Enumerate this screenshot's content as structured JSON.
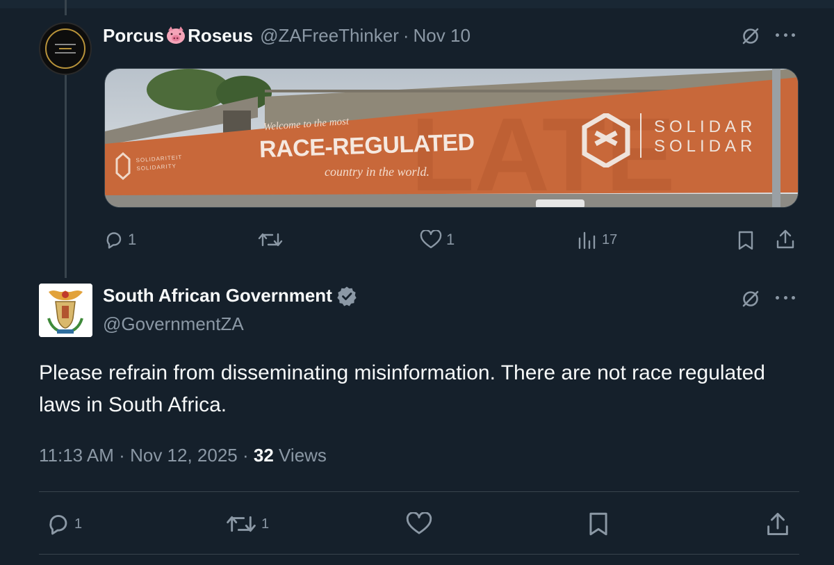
{
  "reply_tweet": {
    "display_name_first": "Porcus",
    "display_name_emoji": "pig-face-emoji",
    "display_name_second": "Roseus",
    "handle": "@ZAFreeThinker",
    "separator": "·",
    "date": "Nov 10",
    "media": {
      "banner_line1": "Welcome to the most",
      "banner_headline": "RACE-REGULATED",
      "banner_line3": "country in the world.",
      "brand_right_1": "SOLIDAR",
      "brand_right_2": "SOLIDAR",
      "brand_left_1": "SOLIDARITEIT",
      "brand_left_2": "SOLIDARITY",
      "banner_color": "#c8683a"
    },
    "stats": {
      "replies": "1",
      "reposts": "",
      "likes": "1",
      "views": "17"
    }
  },
  "main_tweet": {
    "display_name": "South African Government",
    "verified": true,
    "handle": "@GovernmentZA",
    "text": "Please refrain from disseminating misinformation. There are not race regulated laws in South Africa.",
    "time": "11:13 AM",
    "separator": "·",
    "date": "Nov 12, 2025",
    "separator2": "·",
    "views_count": "32",
    "views_label": "Views",
    "stats": {
      "replies": "1",
      "reposts": "1",
      "likes": ""
    }
  },
  "icons": [
    "grok-icon",
    "more-icon",
    "reply-icon",
    "repost-icon",
    "like-icon",
    "views-icon",
    "bookmark-icon",
    "share-icon",
    "verified-badge-icon"
  ],
  "colors": {
    "background": "#15202b",
    "text": "#f7f9f9",
    "muted": "#8b98a5",
    "divider": "#38444d",
    "verified": "#8b98a5"
  }
}
